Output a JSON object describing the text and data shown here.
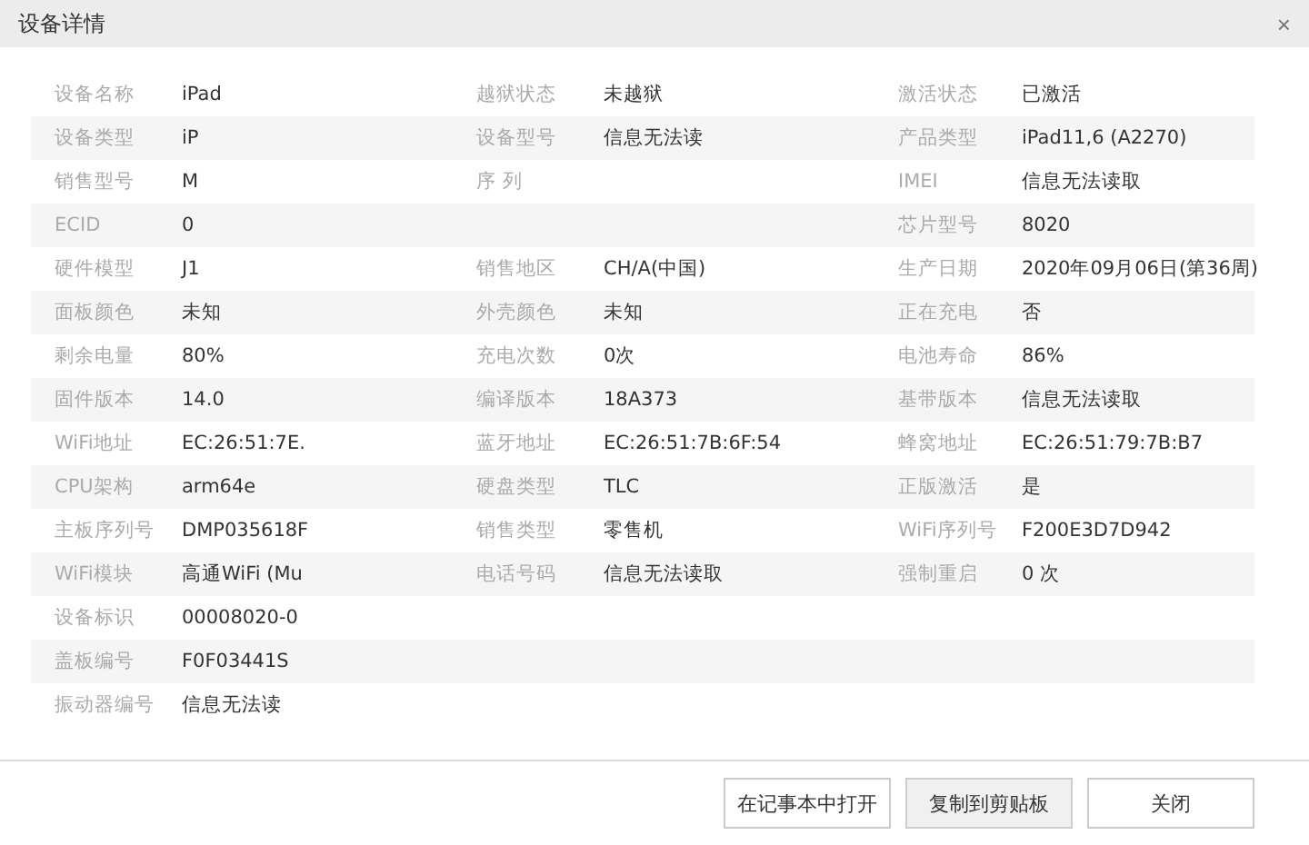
{
  "window": {
    "title": "设备详情",
    "close": "×"
  },
  "rows": [
    [
      {
        "label": "设备名称",
        "value": "iPad"
      },
      {
        "label": "越狱状态",
        "value": "未越狱"
      },
      {
        "label": "激活状态",
        "value": "已激活"
      }
    ],
    [
      {
        "label": "设备类型",
        "value": "iP"
      },
      {
        "label": "设备型号",
        "value": "信息无法读"
      },
      {
        "label": "产品类型",
        "value": "iPad11,6 (A2270)"
      }
    ],
    [
      {
        "label": "销售型号",
        "value": "M"
      },
      {
        "label": "序 列"
      },
      {
        "label": "IMEI",
        "value": "信息无法读取"
      }
    ],
    [
      {
        "label": "ECID",
        "value": "0"
      },
      {},
      {
        "label": "芯片型号",
        "value": "8020"
      }
    ],
    [
      {
        "label": "硬件模型",
        "value": "J1"
      },
      {
        "label": "销售地区",
        "value": "CH/A(中国)"
      },
      {
        "label": "生产日期",
        "value": "2020年09月06日(第36周)"
      }
    ],
    [
      {
        "label": "面板颜色",
        "value": "未知"
      },
      {
        "label": "外壳颜色",
        "value": "未知"
      },
      {
        "label": "正在充电",
        "value": "否"
      }
    ],
    [
      {
        "label": "剩余电量",
        "value": "80%"
      },
      {
        "label": "充电次数",
        "value": "0次"
      },
      {
        "label": "电池寿命",
        "value": "86%"
      }
    ],
    [
      {
        "label": "固件版本",
        "value": "14.0"
      },
      {
        "label": "编译版本",
        "value": "18A373"
      },
      {
        "label": "基带版本",
        "value": "信息无法读取"
      }
    ],
    [
      {
        "label": "WiFi地址",
        "value": "EC:26:51:7E."
      },
      {
        "label": "蓝牙地址",
        "value": "EC:26:51:7B:6F:54"
      },
      {
        "label": "蜂窝地址",
        "value": "EC:26:51:79:7B:B7"
      }
    ],
    [
      {
        "label": "CPU架构",
        "value": "arm64e"
      },
      {
        "label": "硬盘类型",
        "value": "TLC"
      },
      {
        "label": "正版激活",
        "value": "是"
      }
    ],
    [
      {
        "label": "主板序列号",
        "value": "DMP035618F"
      },
      {
        "label": "销售类型",
        "value": "零售机"
      },
      {
        "label": "WiFi序列号",
        "value": "F200E3D7D942"
      }
    ],
    [
      {
        "label": "WiFi模块",
        "value": "高通WiFi (Mu"
      },
      {
        "label": "电话号码",
        "value": "信息无法读取"
      },
      {
        "label": "强制重启",
        "value": "0 次"
      }
    ],
    [
      {
        "label": "设备标识",
        "value": "00008020-0"
      }
    ],
    [
      {
        "label": "盖板编号",
        "value": "F0F03441S"
      }
    ],
    [
      {
        "label": "振动器编号",
        "value": "信息无法读"
      }
    ]
  ],
  "buttons": [
    {
      "label": "在记事本中打开",
      "highlighted": false
    },
    {
      "label": "复制到剪贴板",
      "highlighted": true
    },
    {
      "label": "关闭",
      "highlighted": false
    }
  ]
}
